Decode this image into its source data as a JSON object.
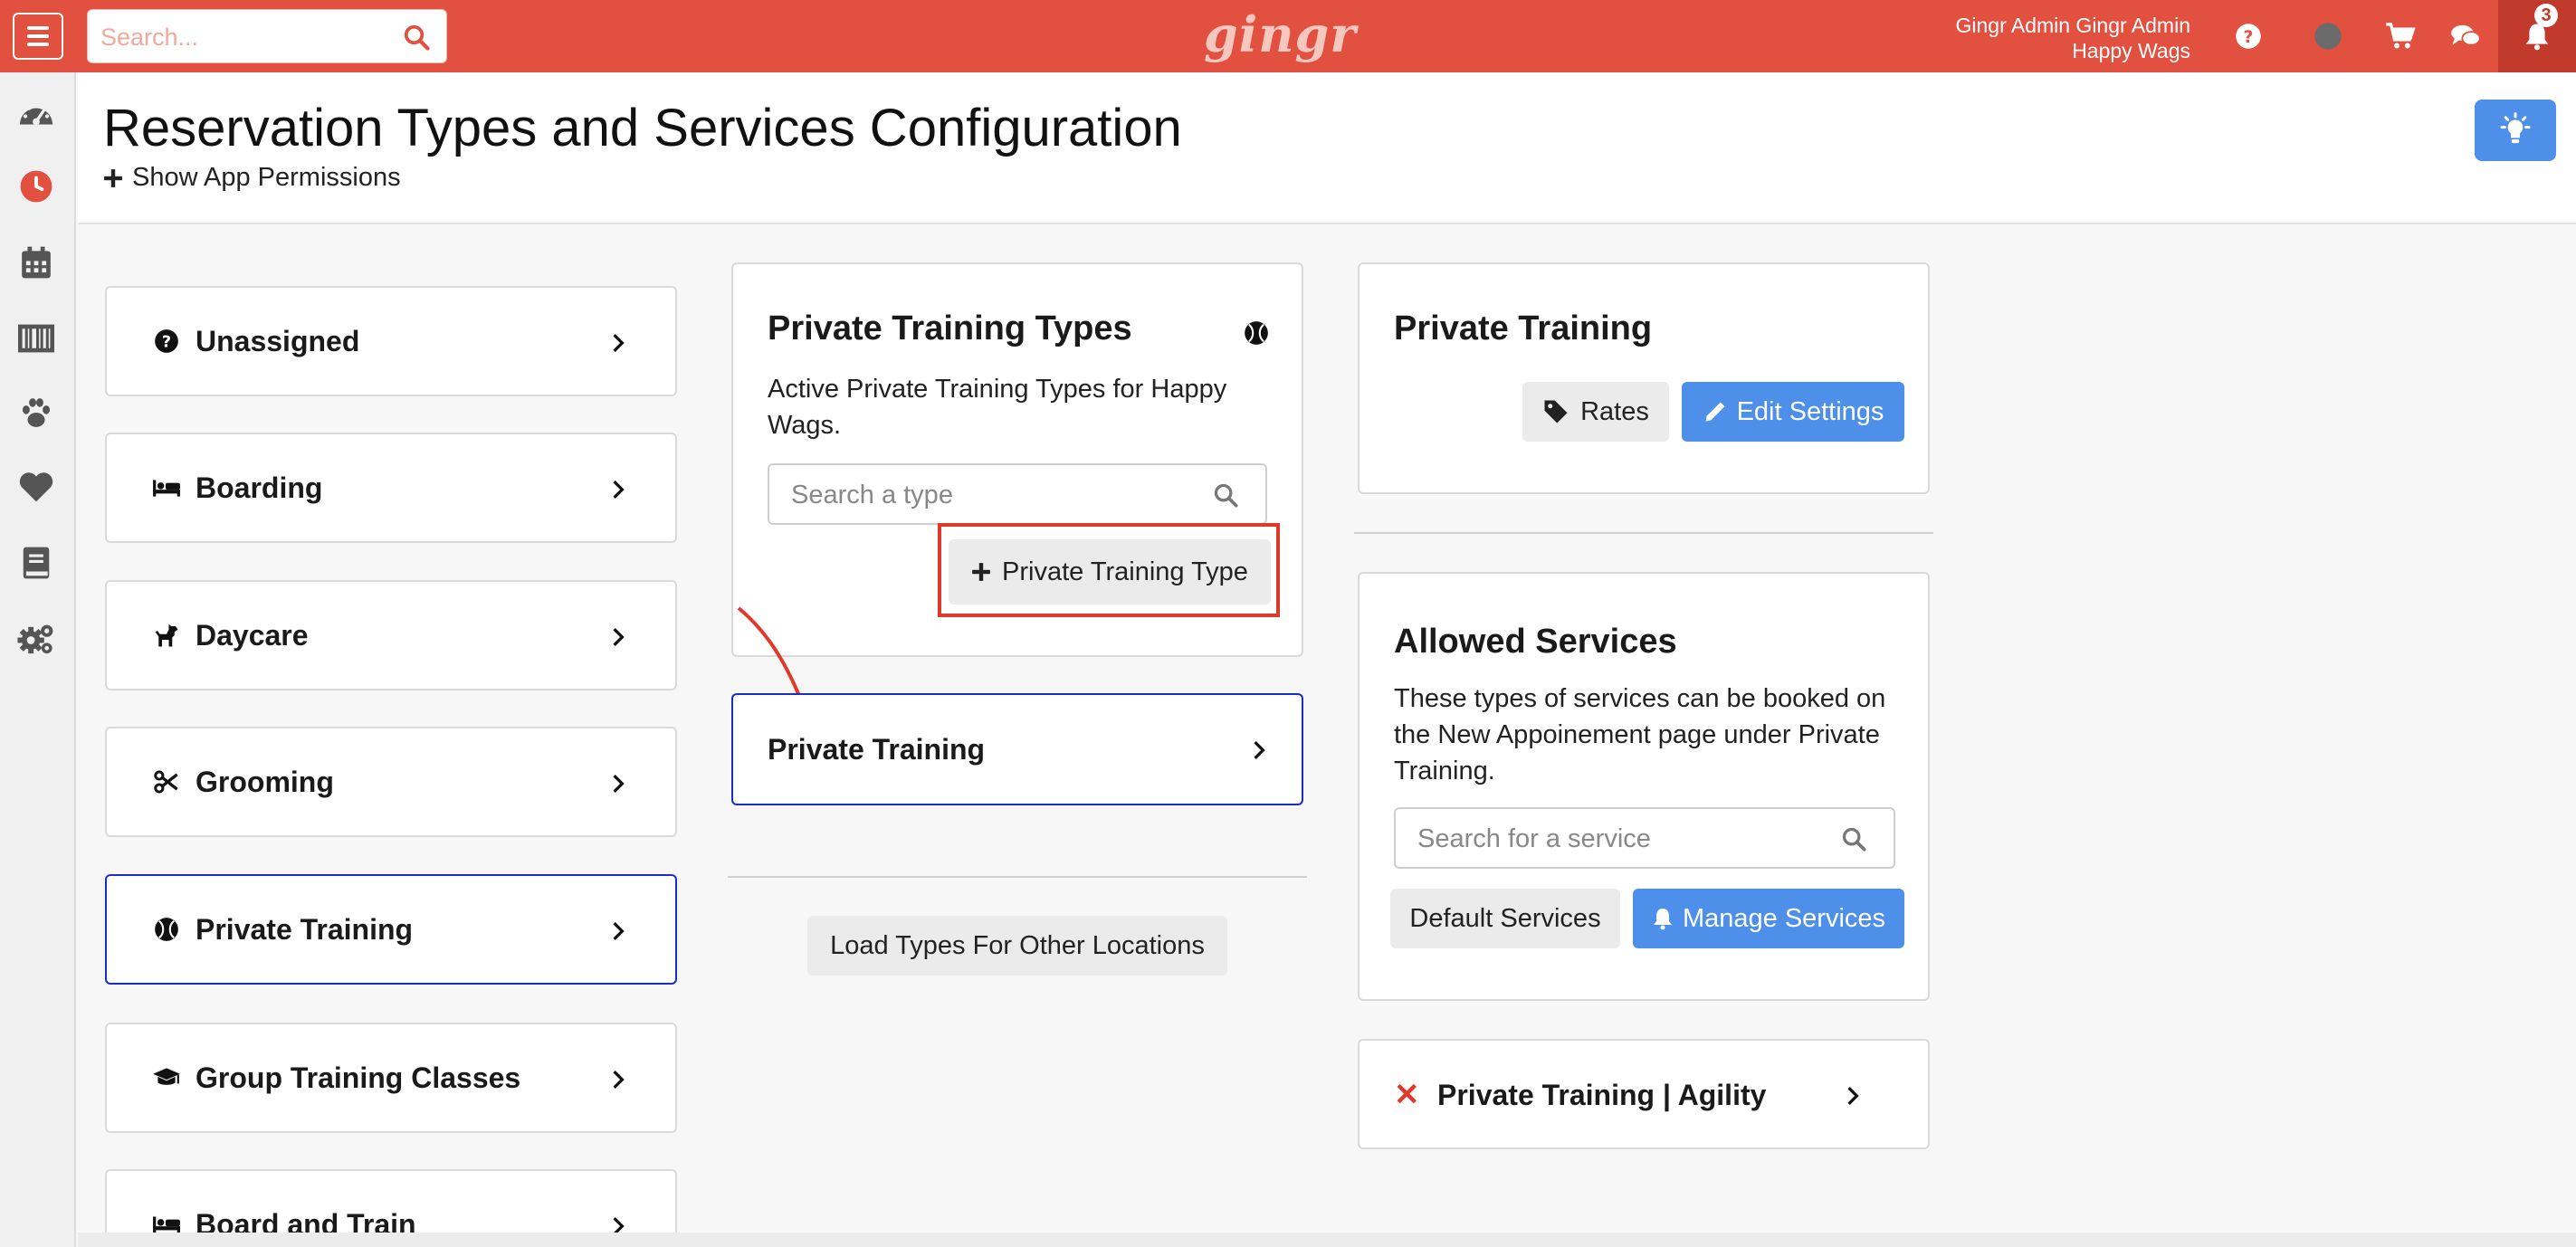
{
  "topbar": {
    "search_placeholder": "Search...",
    "logo": "gingr",
    "user_name": "Gingr Admin Gingr Admin",
    "location": "Happy Wags",
    "notification_count": "3",
    "colors": {
      "bar": "#e2503f",
      "bell_bg": "#c0392b"
    }
  },
  "sidebar": {
    "icons": [
      "dashboard-icon",
      "clock-icon",
      "calendar-icon",
      "barcode-icon",
      "paw-icon",
      "heart-icon",
      "book-icon",
      "gears-icon"
    ]
  },
  "header": {
    "title": "Reservation Types and Services Configuration",
    "permissions_link": "Show App Permissions"
  },
  "categories": [
    {
      "label": "Unassigned",
      "icon": "question-circle-icon"
    },
    {
      "label": "Boarding",
      "icon": "bed-icon"
    },
    {
      "label": "Daycare",
      "icon": "dog-icon"
    },
    {
      "label": "Grooming",
      "icon": "scissors-icon"
    },
    {
      "label": "Private Training",
      "icon": "ball-icon",
      "active": true
    },
    {
      "label": "Group Training Classes",
      "icon": "graduation-cap-icon"
    },
    {
      "label": "Board and Train",
      "icon": "bed-icon"
    }
  ],
  "types_panel": {
    "title": "Private Training Types",
    "description": "Active Private Training Types for Happy Wags.",
    "search_placeholder": "Search a type",
    "add_button": "Private Training Type",
    "type_item": "Private Training",
    "load_button": "Load Types For Other Locations"
  },
  "settings_panel": {
    "title": "Private Training",
    "rates_button": "Rates",
    "edit_button": "Edit Settings"
  },
  "services_panel": {
    "title": "Allowed Services",
    "description": "These types of services can be booked on the New Appoinement page under Private Training.",
    "search_placeholder": "Search for a service",
    "default_button": "Default Services",
    "manage_button": "Manage Services",
    "service_item": "Private Training | Agility"
  },
  "colors": {
    "accent_blue": "#4d8fe9",
    "active_border": "#1a2ec7",
    "highlight_red": "#e0392a"
  }
}
